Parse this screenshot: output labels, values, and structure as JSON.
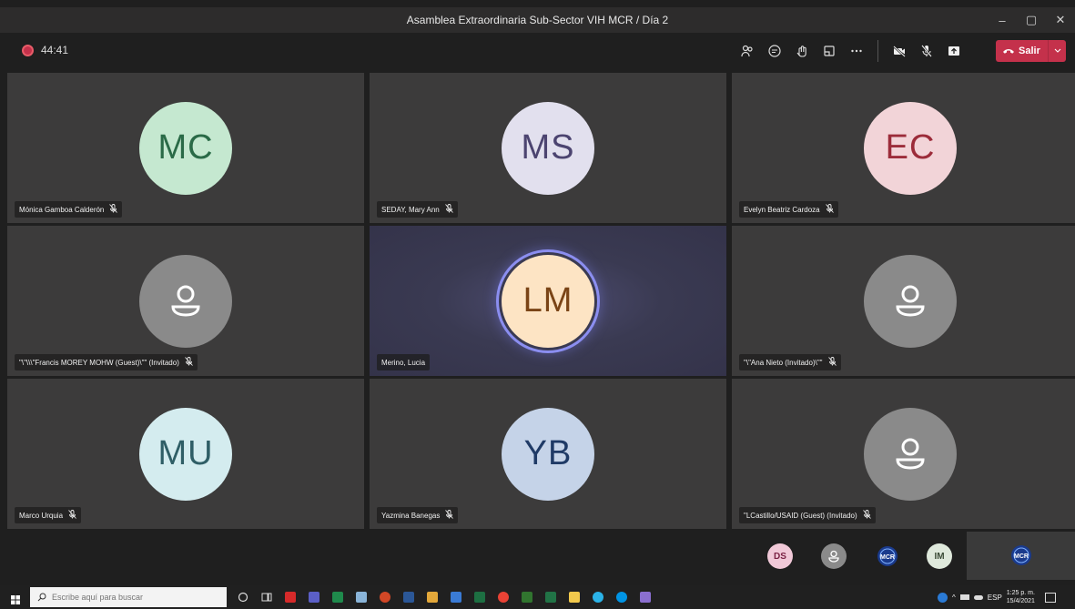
{
  "window": {
    "title": "Asamblea Extraordinaria Sub-Sector VIH MCR / Día 2",
    "controls": [
      "–",
      "▢",
      "✕"
    ]
  },
  "toolbar": {
    "timer": "44:41",
    "leave_label": "Salir",
    "leave_color": "#c4314b",
    "icons": [
      "participants-icon",
      "chat-icon",
      "reactions-icon",
      "rooms-icon",
      "more-icon",
      "camera-off-icon",
      "mic-off-icon",
      "share-icon"
    ]
  },
  "tiles": [
    {
      "initials": "MC",
      "name": "Mónica Gamboa Calderón",
      "bg": "#c5e8d0",
      "fg": "#2a6a47",
      "muted": true
    },
    {
      "initials": "MS",
      "name": "SEDAY, Mary Ann",
      "bg": "#e2e0ee",
      "fg": "#4c4470",
      "muted": true
    },
    {
      "initials": "EC",
      "name": "Evelyn Beatriz Cardoza",
      "bg": "#f2d4d8",
      "fg": "#9c2c3a",
      "muted": true
    },
    {
      "initials": "",
      "name": "\"\\\"\\\\\\\"Francis MOREY MOHW (Guest)\\\"\" (Invitado)",
      "guest": true,
      "muted": true
    },
    {
      "initials": "LM",
      "name": "Merino, Lucia",
      "bg": "#fde4c4",
      "fg": "#7a4416",
      "muted": false,
      "active": true
    },
    {
      "initials": "",
      "name": "\"\\\"Ana Nieto (Invitado)\\\"\"",
      "guest": true,
      "muted": true
    },
    {
      "initials": "MU",
      "name": "Marco Urquia",
      "bg": "#d4ecef",
      "fg": "#2f5e66",
      "muted": true
    },
    {
      "initials": "YB",
      "name": "Yazmina Banegas",
      "bg": "#c5d3e8",
      "fg": "#1f3a66",
      "muted": true
    },
    {
      "initials": "",
      "name": "\"LCastillo/USAID (Guest) (Invitado)",
      "guest": true,
      "muted": true
    }
  ],
  "strip": [
    {
      "initials": "DS",
      "bg": "#f1c9d8",
      "fg": "#7a2244"
    },
    {
      "initials": "",
      "guest": true
    },
    {
      "initials": "MCR",
      "logo": true
    },
    {
      "initials": "IM",
      "bg": "#dfe9dc",
      "fg": "#3a4a36"
    }
  ],
  "self_view": {
    "label": "MCR"
  },
  "taskbar": {
    "search_placeholder": "Escribe aquí para buscar",
    "lang": "ESP",
    "time": "1:25 p. m.",
    "date": "15/4/2021"
  }
}
